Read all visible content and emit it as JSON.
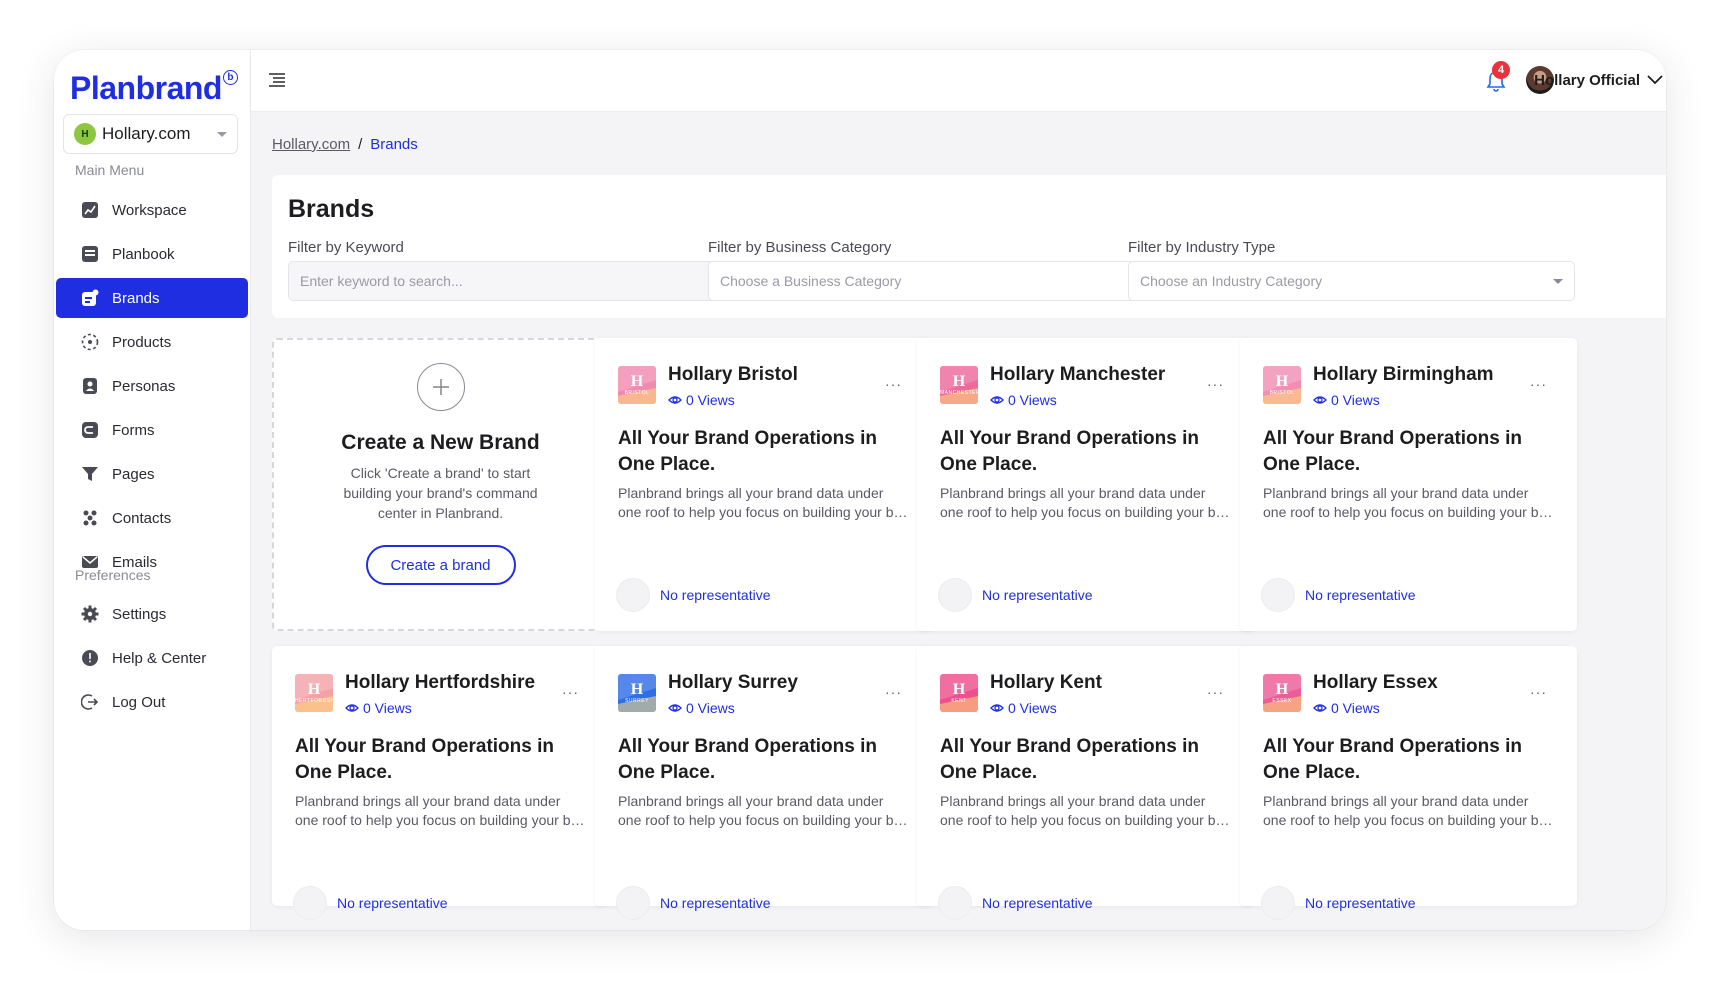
{
  "app": {
    "logo": "Planbrand",
    "logo_badge": "b",
    "workspace": {
      "name": "Hollary.com",
      "initials": "H"
    }
  },
  "sidebar": {
    "main_menu_label": "Main Menu",
    "preferences_label": "Preferences",
    "main_items": [
      {
        "label": "Workspace",
        "icon": "workspace-icon"
      },
      {
        "label": "Planbook",
        "icon": "planbook-icon"
      },
      {
        "label": "Brands",
        "icon": "brands-icon",
        "active": true
      },
      {
        "label": "Products",
        "icon": "products-icon"
      },
      {
        "label": "Personas",
        "icon": "personas-icon"
      },
      {
        "label": "Forms",
        "icon": "forms-icon"
      },
      {
        "label": "Pages",
        "icon": "pages-icon"
      },
      {
        "label": "Contacts",
        "icon": "contacts-icon"
      },
      {
        "label": "Emails",
        "icon": "emails-icon"
      }
    ],
    "pref_items": [
      {
        "label": "Settings",
        "icon": "settings-icon"
      },
      {
        "label": "Help & Center",
        "icon": "help-icon"
      },
      {
        "label": "Log Out",
        "icon": "logout-icon"
      }
    ]
  },
  "topbar": {
    "notification_count": "4",
    "user_name": "Hollary Official"
  },
  "breadcrumb": {
    "root": "Hollary.com",
    "separator": "/",
    "current": "Brands"
  },
  "filters": {
    "title": "Brands",
    "keyword": {
      "label": "Filter by Keyword",
      "placeholder": "Enter keyword to search..."
    },
    "business": {
      "label": "Filter by Business Category",
      "placeholder": "Choose a Business Category"
    },
    "industry": {
      "label": "Filter by Industry Type",
      "placeholder": "Choose an Industry Category"
    }
  },
  "create_card": {
    "title": "Create a New Brand",
    "description": "Click 'Create a brand' to start building your brand's command center in Planbrand.",
    "button": "Create a brand"
  },
  "brands": [
    {
      "name": "Hollary Bristol",
      "tag": "BRISTOL",
      "views": "0 Views",
      "heading": "All Your Brand Operations in One Place.",
      "desc_line1": "Planbrand brings all your brand data under",
      "desc_line2": "one roof to help you focus on building your brand",
      "representative": "No representative",
      "logo_color": "#f08bb0"
    },
    {
      "name": "Hollary Manchester",
      "tag": "MANCHESTER",
      "views": "0 Views",
      "heading": "All Your Brand Operations in One Place.",
      "desc_line1": "Planbrand brings all your brand data under",
      "desc_line2": "one roof to help you focus on building your brand",
      "representative": "No representative",
      "logo_color": "#ee6a9a"
    },
    {
      "name": "Hollary Birmingham",
      "tag": "BRISTOL",
      "views": "0 Views",
      "heading": "All Your Brand Operations in One Place.",
      "desc_line1": "Planbrand brings all your brand data under",
      "desc_line2": "one roof to help you focus on building your brand",
      "representative": "No representative",
      "logo_color": "#f18fb3"
    },
    {
      "name": "Hollary Hertfordshire",
      "tag": "HERTFORDSHIRE",
      "views": "0 Views",
      "heading": "All Your Brand Operations in One Place.",
      "desc_line1": "Planbrand brings all your brand data under",
      "desc_line2": "one roof to help you focus on building your brand",
      "representative": "No representative",
      "logo_color": "#f4a1a6"
    },
    {
      "name": "Hollary Surrey",
      "tag": "SURREY",
      "views": "0 Views",
      "heading": "All Your Brand Operations in One Place.",
      "desc_line1": "Planbrand brings all your brand data under",
      "desc_line2": "one roof to help you focus on building your brand",
      "representative": "No representative",
      "logo_color": "#2f6fe6"
    },
    {
      "name": "Hollary Kent",
      "tag": "KENT",
      "views": "0 Views",
      "heading": "All Your Brand Operations in One Place.",
      "desc_line1": "Planbrand brings all your brand data under",
      "desc_line2": "one roof to help you focus on building your brand",
      "representative": "No representative",
      "logo_color": "#ee4f8d"
    },
    {
      "name": "Hollary Essex",
      "tag": "ESSEX",
      "views": "0 Views",
      "heading": "All Your Brand Operations in One Place.",
      "desc_line1": "Planbrand brings all your brand data under",
      "desc_line2": "one roof to help you focus on building your brand",
      "representative": "No representative",
      "logo_color": "#ec5c95"
    }
  ]
}
